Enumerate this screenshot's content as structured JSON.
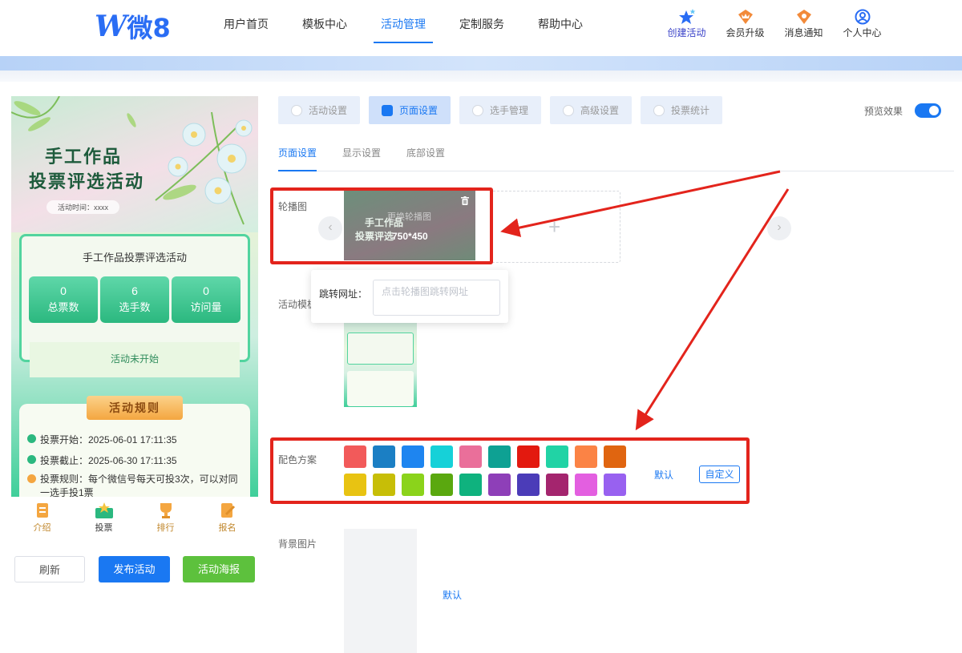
{
  "brand": {
    "logo_letter": "W",
    "logo_text": "微8"
  },
  "nav": {
    "items": [
      "用户首页",
      "模板中心",
      "活动管理",
      "定制服务",
      "帮助中心"
    ],
    "active_index": 2
  },
  "tools": [
    {
      "label": "创建活动",
      "icon": "star-icon"
    },
    {
      "label": "会员升级",
      "icon": "crown-icon"
    },
    {
      "label": "消息通知",
      "icon": "bell-icon"
    },
    {
      "label": "个人中心",
      "icon": "user-icon"
    }
  ],
  "phone": {
    "title_line1": "手工作品",
    "title_line2": "投票评选活动",
    "time_label": "活动时间：xxxx",
    "card_title": "手工作品投票评选活动",
    "stats": [
      {
        "value": "0",
        "label": "总票数"
      },
      {
        "value": "6",
        "label": "选手数"
      },
      {
        "value": "0",
        "label": "访问量"
      }
    ],
    "status": "活动未开始",
    "rules_title": "活动规则",
    "rules": [
      "投票开始：2025-06-01 17:11:35",
      "投票截止：2025-06-30 17:11:35",
      "投票规则：每个微信号每天可投3次，可以对同一选手投1票"
    ],
    "tabs": [
      {
        "label": "介绍",
        "icon": "doc-icon"
      },
      {
        "label": "投票",
        "icon": "vote-icon"
      },
      {
        "label": "排行",
        "icon": "trophy-icon"
      },
      {
        "label": "报名",
        "icon": "signup-icon"
      }
    ],
    "active_tab": 1
  },
  "actions": {
    "refresh": "刷新",
    "publish": "发布活动",
    "poster": "活动海报"
  },
  "settings": {
    "tabs": [
      "活动设置",
      "页面设置",
      "选手管理",
      "高级设置",
      "投票统计"
    ],
    "active_tab": 1,
    "preview_label": "预览效果",
    "preview_on": true,
    "subtabs": [
      "页面设置",
      "显示设置",
      "底部设置"
    ],
    "active_subtab": 0,
    "carousel": {
      "label": "轮播图",
      "replace_label": "更换轮播图",
      "size_label": "750*450",
      "thumb_line1": "手工作品",
      "thumb_line2": "投票评选",
      "prev": "‹",
      "next": "›",
      "add": "+"
    },
    "jump": {
      "label": "跳转网址：",
      "placeholder": "点击轮播图跳转网址"
    },
    "template_label": "活动模板",
    "color_label": "配色方案",
    "colors": [
      "#f25a5a",
      "#1b7fc4",
      "#1e85f0",
      "#16d1d8",
      "#ea6f9a",
      "#0ea193",
      "#e3190f",
      "#21d3a5",
      "#fb8345",
      "#e06510",
      "#e8c312",
      "#c7be07",
      "#8bd31b",
      "#5aa80f",
      "#0fb27e",
      "#8e3fb8",
      "#4b3cb8",
      "#a4256e",
      "#e35fe0",
      "#9861f0"
    ],
    "color_default": "默认",
    "color_custom": "自定义",
    "bg_label": "背景图片",
    "bg_default": "默认"
  }
}
